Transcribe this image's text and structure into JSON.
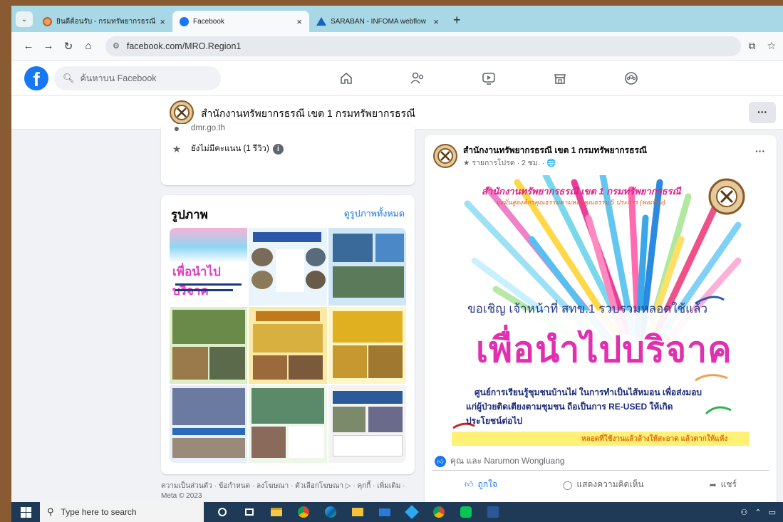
{
  "browser": {
    "tabs": [
      {
        "label": "ยินดีต้อนรับ - กรมทรัพยากรธรณี",
        "icon": "site-favicon",
        "active": false
      },
      {
        "label": "Facebook",
        "icon": "facebook-favicon",
        "active": true
      },
      {
        "label": "SARABAN - INFOMA webflow",
        "icon": "saraban-favicon",
        "active": false
      }
    ],
    "tab_close": "×",
    "new_tab": "+",
    "url": "facebook.com/MRO.Region1"
  },
  "facebook": {
    "logo": "f",
    "search_placeholder": "ค้นหาบน Facebook",
    "nav_icons": [
      "home-icon",
      "friends-icon",
      "watch-icon",
      "marketplace-icon",
      "groups-icon"
    ]
  },
  "page": {
    "name": "สำนักงานทรัพยากรธรณี เขต 1 กรมทรัพยากรธรณี",
    "more": "···"
  },
  "info": {
    "website": "dmr.go.th",
    "rating": "ยังไม่มีคะแนน (1 รีวิว)",
    "info_badge": "i"
  },
  "photos": {
    "title": "รูปภาพ",
    "see_all": "ดูรูปภาพทั้งหมด",
    "tile_text": "เพื่อนำไปบริจาค"
  },
  "footer": {
    "text": "ความเป็นส่วนตัว · ข้อกำหนด · ลงโฆษณา · ตัวเลือกโฆษณา ▷ · คุกกี้ · เพิ่มเติม · Meta © 2023"
  },
  "post": {
    "author": "สำนักงานทรัพยากรธรณี เขต 1 กรมทรัพยากรธรณี",
    "meta": "★ รายการโปรด · 2 ชม. · 🌐",
    "more": "···",
    "image": {
      "top_title": "สำนักงานทรัพยากรธรณี เขต 1 กรมทรัพยากรธรณี",
      "top_subtitle": "มุ่งมั่นสู่องค์กรคุณธรรมตามหลักคุณธรรม 5 ประการ (พอเพียง)",
      "invite": "ขอเชิญ เจ้าหน้าที่ สทข.1 รวบรวมหลอดใช้แล้ว",
      "headline": "เพื่อนำไปบริจาค",
      "body_line1": "ศูนย์การเรียนรู้ชุมชนบ้านไผ่ ในการทำเป็นไส้หมอน เพื่อส่งมอบ",
      "body_line2": "แก่ผู้ป่วยติดเตียงตามชุมชน ถือเป็นการ RE-USED ให้เกิด",
      "body_line3": "ประโยชน์ต่อไป",
      "note": "หลอดที่ใช้งานแล้วล้างให้สะอาด แล้วตากให้แห้ง"
    },
    "reactions": "คุณ และ Narumon Wongluang",
    "like": "ถูกใจ",
    "comment": "แสดงความคิดเห็น",
    "share": "แชร์"
  },
  "taskbar": {
    "search_placeholder": "Type here to search",
    "apps": [
      "task-view-icon",
      "file-explorer-icon",
      "chrome-icon",
      "edge-icon",
      "explorer-icon",
      "mail-icon",
      "app-icon",
      "chrome-profile-icon",
      "line-icon",
      "word-icon"
    ]
  }
}
